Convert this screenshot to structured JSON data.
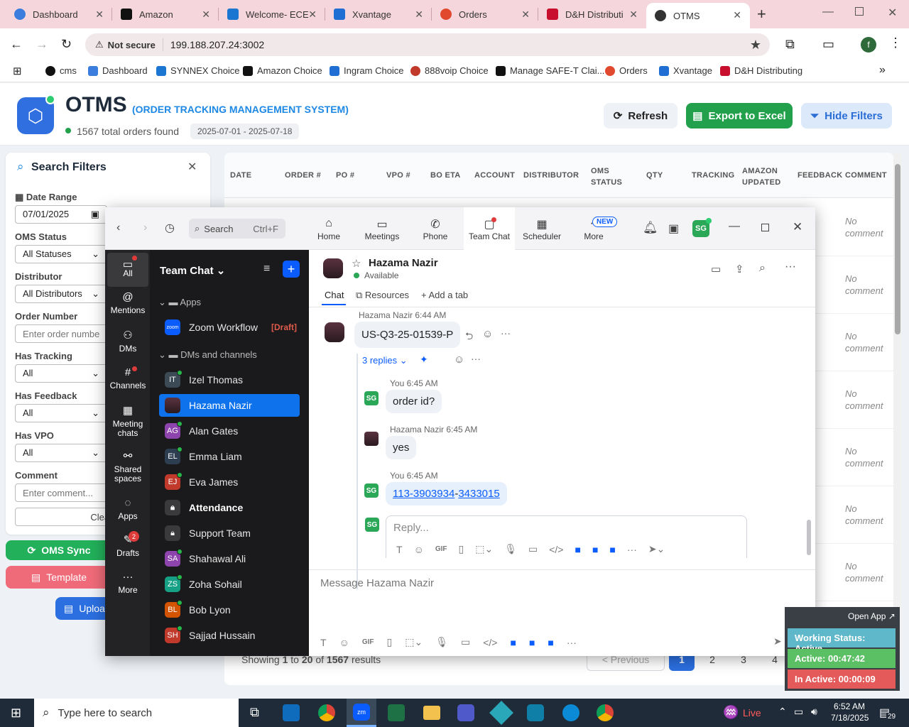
{
  "browser": {
    "tabs": [
      {
        "label": "Dashboard",
        "color": "#3b7ddd"
      },
      {
        "label": "Amazon",
        "color": "#111111"
      },
      {
        "label": "Welcome- ECE",
        "color": "#1b76d2"
      },
      {
        "label": "Xvantage",
        "color": "#1f6ed4"
      },
      {
        "label": "Orders",
        "color": "#e0492d"
      },
      {
        "label": "D&H Distributi",
        "color": "#c8102e"
      },
      {
        "label": "OTMS",
        "color": "#333333"
      }
    ],
    "not_secure": "Not secure",
    "url": "199.188.207.24:3002",
    "profile_initial": "f",
    "bookmarks": [
      "cms",
      "Dashboard",
      "SYNNEX Choice",
      "Amazon Choice",
      "Ingram Choice",
      "888voip Choice",
      "Manage SAFE-T Clai...",
      "Orders",
      "Xvantage",
      "D&H Distributing"
    ]
  },
  "app": {
    "title": "OTMS",
    "subtitle": "(ORDER TRACKING MANAGEMENT SYSTEM)",
    "orders_found": "1567 total orders found",
    "date_range_badge": "2025-07-01 - 2025-07-18",
    "refresh": "Refresh",
    "export": "Export to Excel",
    "hide_filters": "Hide Filters",
    "accent": "#1e88e5",
    "green": "#22a04b"
  },
  "filters": {
    "title": "Search Filters",
    "date_range_label": "Date Range",
    "date_value": "07/01/2025",
    "oms_status_label": "OMS Status",
    "oms_status_value": "All Statuses",
    "distributor_label": "Distributor",
    "distributor_value": "All Distributors",
    "order_number_label": "Order Number",
    "order_number_placeholder": "Enter order number...",
    "has_tracking_label": "Has Tracking",
    "has_tracking_value": "All",
    "has_feedback_label": "Has Feedback",
    "has_feedback_value": "All",
    "has_vpo_label": "Has VPO",
    "has_vpo_value": "All",
    "comment_label": "Comment",
    "comment_placeholder": "Enter comment...",
    "clear": "Clear A",
    "oms_sync": "OMS Sync",
    "template": "Template",
    "upload": "Uploa"
  },
  "table": {
    "headers": [
      "DATE",
      "ORDER #",
      "PO #",
      "VPO #",
      "BO ETA",
      "ACCOUNT",
      "DISTRIBUTOR",
      "OMS STATUS",
      "QTY",
      "TRACKING",
      "AMAZON UPDATED",
      "FEEDBACK",
      "COMMENT"
    ],
    "comments": [
      "No comment",
      "No comment",
      "No comment",
      "No comment",
      "No comment",
      "No comment",
      "No comment"
    ],
    "showing_prefix": "Showing ",
    "showing_from": "1",
    "showing_to_word": " to ",
    "showing_to": "20",
    "showing_of_word": " of ",
    "showing_total": "1567",
    "showing_suffix": " results",
    "previous": "< Previous",
    "pages": [
      "1",
      "2",
      "3",
      "4"
    ]
  },
  "zoom": {
    "search": "Search",
    "search_shortcut": "Ctrl+F",
    "tabs": [
      "Home",
      "Meetings",
      "Phone",
      "Team Chat",
      "Scheduler",
      "More"
    ],
    "new_badge": "NEW",
    "user_initials": "SG",
    "rail": [
      {
        "label": "All"
      },
      {
        "label": "Mentions"
      },
      {
        "label": "DMs"
      },
      {
        "label": "Channels"
      },
      {
        "label": "Meeting chats"
      },
      {
        "label": "Shared spaces"
      },
      {
        "label": "Apps"
      },
      {
        "label": "Drafts",
        "badge": "2"
      },
      {
        "label": "More"
      }
    ],
    "list_title": "Team Chat",
    "apps_section": "Apps",
    "zoom_workflow": "Zoom Workflow",
    "draft_tag": "[Draft]",
    "dms_section": "DMs and channels",
    "contacts": [
      {
        "initials": "IT",
        "name": "Izel Thomas",
        "color": "#3b4a55"
      },
      {
        "initials": "",
        "name": "Hazama Nazir",
        "color": "#4a2a34"
      },
      {
        "initials": "AG",
        "name": "Alan Gates",
        "color": "#8e44ad"
      },
      {
        "initials": "EL",
        "name": "Emma Liam",
        "color": "#2c3e50"
      },
      {
        "initials": "EJ",
        "name": "Eva James",
        "color": "#c0392b"
      },
      {
        "initials": "",
        "name": "Attendance",
        "color": "#3a3a3c"
      },
      {
        "initials": "",
        "name": "Support Team",
        "color": "#3a3a3c"
      },
      {
        "initials": "SA",
        "name": "Shahawal Ali",
        "color": "#8e44ad"
      },
      {
        "initials": "ZS",
        "name": "Zoha Sohail",
        "color": "#16a085"
      },
      {
        "initials": "BL",
        "name": "Bob Lyon",
        "color": "#d35400"
      },
      {
        "initials": "SH",
        "name": "Sajjad Hussain",
        "color": "#c0392b"
      }
    ],
    "chat_name": "Hazama Nazir",
    "chat_status": "Available",
    "chat_tabs": [
      "Chat",
      "Resources",
      "Add a tab"
    ],
    "thread": {
      "author": "Hazama Nazir",
      "time": "6:44 AM",
      "message": "US-Q3-25-01539-P",
      "replies": "3 replies"
    },
    "replies": [
      {
        "author": "You",
        "time": "6:45 AM",
        "text": "order id?"
      },
      {
        "author": "Hazama Nazir",
        "time": "6:45 AM",
        "text": "yes"
      },
      {
        "author": "You",
        "time": "6:45 AM",
        "link1": "113-3903934",
        "dash": "-",
        "link2": "3433015"
      }
    ],
    "reply_placeholder": "Reply...",
    "message_placeholder": "Message Hazama Nazir"
  },
  "widget": {
    "open_app": "Open App",
    "working": "Working Status: Active",
    "active": "Active: 00:47:42",
    "inactive": "In Active: 00:00:09"
  },
  "taskbar": {
    "search_placeholder": "Type here to search",
    "weather": "Live",
    "time": "6:52 AM",
    "date": "7/18/2025",
    "notifications": "29"
  }
}
